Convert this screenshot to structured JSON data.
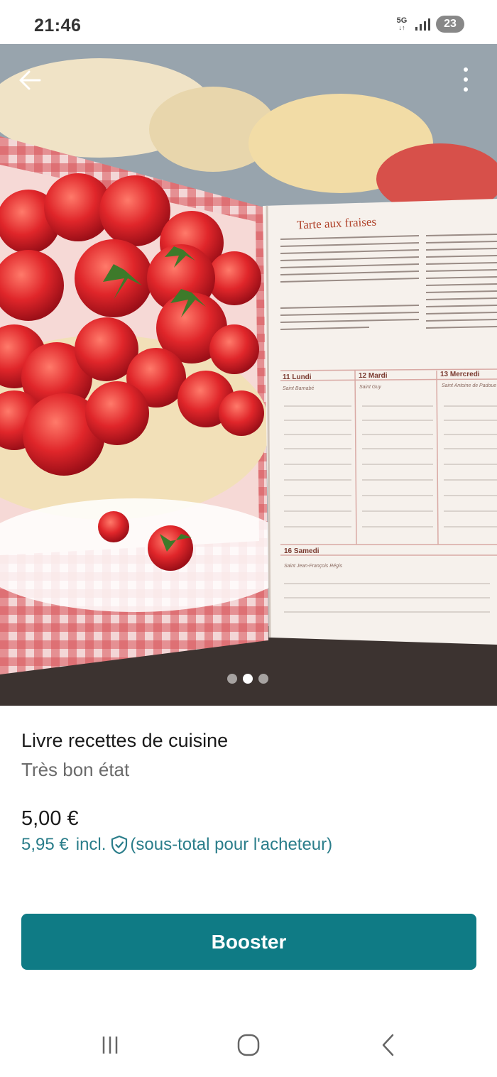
{
  "status_bar": {
    "time": "21:46",
    "network": "5G",
    "battery": "23",
    "icons": [
      "network-5g-icon",
      "signal-icon",
      "battery-icon"
    ]
  },
  "photo": {
    "carousel_total": 3,
    "carousel_active": 2,
    "book_title": "Tarte aux fraises",
    "days": [
      {
        "label": "11 Lundi",
        "saint": "Saint Barnabé"
      },
      {
        "label": "12 Mardi",
        "saint": "Saint Guy"
      },
      {
        "label": "13 Mercredi",
        "saint": "Saint Antoine de Padoue"
      },
      {
        "label": "16 Samedi",
        "saint": "Saint Jean-François Régis"
      }
    ]
  },
  "item": {
    "title": "Livre recettes de cuisine",
    "condition": "Très bon état",
    "price": "5,00 €",
    "price_buyer": "5,95 €",
    "incl_label": "incl.",
    "buyer_note": "(sous-total pour l'acheteur)"
  },
  "actions": {
    "boost_label": "Booster"
  },
  "colors": {
    "accent": "#0f7b85",
    "link": "#2a7d8a"
  }
}
